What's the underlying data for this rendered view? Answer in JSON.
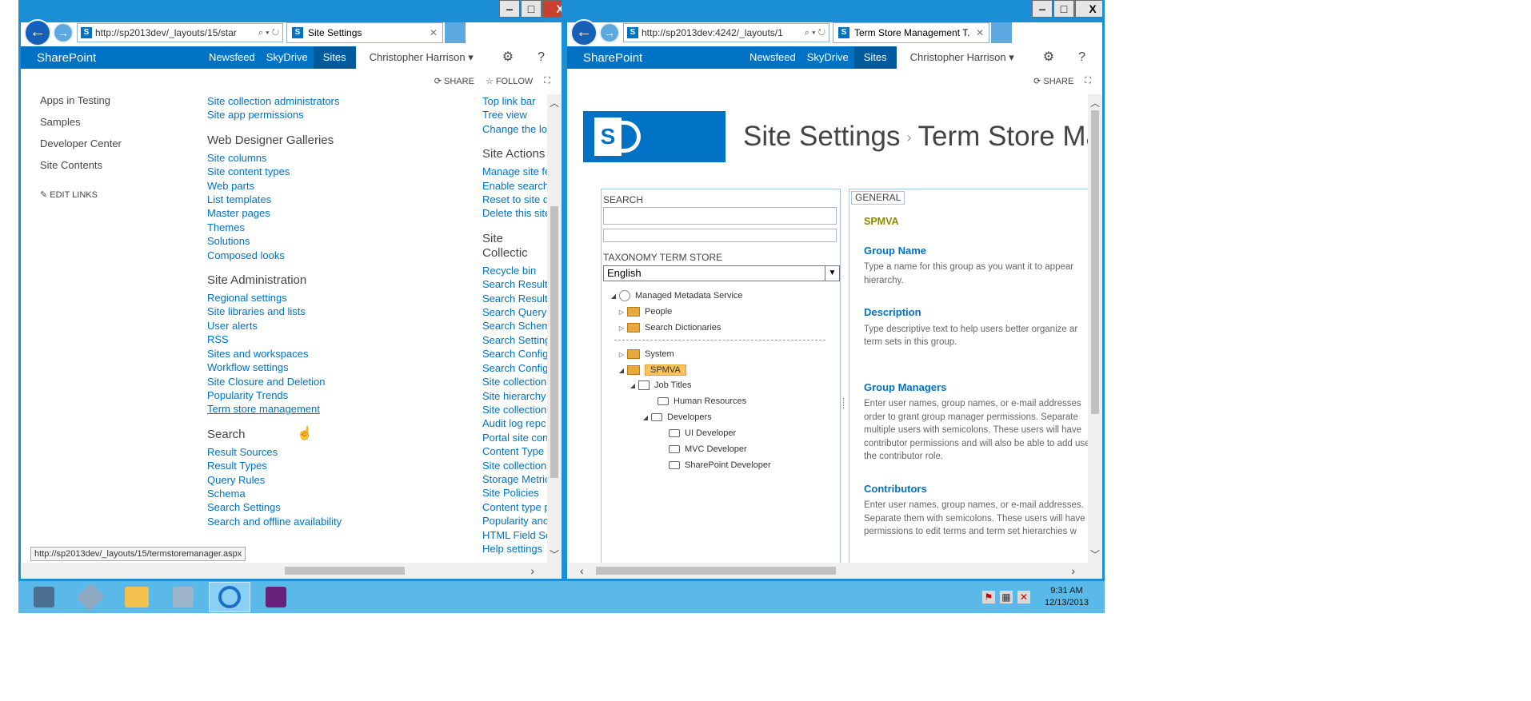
{
  "left_window": {
    "url": "http://sp2013dev/_layouts/15/star",
    "url_host": "sp2013dev",
    "url_tools": "⌕ ▾ ↻",
    "tab_title": "Site Settings",
    "suite": {
      "brand": "SharePoint",
      "links": [
        "Newsfeed",
        "SkyDrive",
        "Sites"
      ],
      "user": "Christopher Harrison ▾"
    },
    "actions": [
      "⟳ SHARE",
      "☆ FOLLOW",
      "⛶"
    ],
    "quicklaunch": [
      "Apps in Testing",
      "Samples",
      "Developer Center",
      "Site Contents"
    ],
    "edit_links": "✎  EDIT LINKS",
    "col1": {
      "top_links": [
        "Site collection administrators",
        "Site app permissions"
      ],
      "web_designer_header": "Web Designer Galleries",
      "web_designer": [
        "Site columns",
        "Site content types",
        "Web parts",
        "List templates",
        "Master pages",
        "Themes",
        "Solutions",
        "Composed looks"
      ],
      "site_admin_header": "Site Administration",
      "site_admin": [
        "Regional settings",
        "Site libraries and lists",
        "User alerts",
        "RSS",
        "Sites and workspaces",
        "Workflow settings",
        "Site Closure and Deletion",
        "Popularity Trends",
        "Term store management"
      ],
      "search_header": "Search",
      "search": [
        "Result Sources",
        "Result Types",
        "Query Rules",
        "Schema",
        "Search Settings",
        "Search and offline availability"
      ]
    },
    "col2": {
      "top_links": [
        "Top link bar",
        "Tree view",
        "Change the lo"
      ],
      "site_actions_header": "Site Actions",
      "site_actions": [
        "Manage site fe",
        "Enable search",
        "Reset to site d",
        "Delete this site"
      ],
      "site_coll_header": "Site Collectic",
      "site_coll": [
        "Recycle bin",
        "Search Result",
        "Search Result",
        "Search Query",
        "Search Schem",
        "Search Setting",
        "Search Config",
        "Search Config",
        "Site collection",
        "Site hierarchy",
        "Site collection",
        "Audit log repc",
        "Portal site con",
        "Content Type",
        "Site collection",
        "Storage Metric",
        "Site Policies",
        "Content type p",
        "Popularity anc",
        "HTML Field Se",
        "Help settings"
      ]
    },
    "status_url": "http://sp2013dev/_layouts/15/termstoremanager.aspx"
  },
  "right_window": {
    "url": "http://sp2013dev:4242/_layouts/1",
    "url_tools": "⌕ ▾ ↻",
    "tab_title": "Term Store Management T...",
    "suite": {
      "brand": "SharePoint",
      "links": [
        "Newsfeed",
        "SkyDrive",
        "Sites"
      ],
      "user": "Christopher Harrison ▾"
    },
    "actions": [
      "⟳ SHARE",
      "⛶"
    ],
    "page_title_1": "Site Settings",
    "page_title_sep": "›",
    "page_title_2": "Term Store Ma",
    "search_label": "SEARCH",
    "taxonomy_label": "TAXONOMY TERM STORE",
    "language": "English",
    "tree": [
      {
        "label": "Managed Metadata Service",
        "exp": "◢"
      },
      {
        "label": "People",
        "exp": "▷"
      },
      {
        "label": "Search Dictionaries",
        "exp": "▷"
      },
      {
        "label": "System",
        "exp": "▷"
      },
      {
        "label": "SPMVA",
        "exp": "◢"
      },
      {
        "label": "Job Titles",
        "exp": "◢"
      },
      {
        "label": "Human Resources",
        "exp": ""
      },
      {
        "label": "Developers",
        "exp": "◢"
      },
      {
        "label": "UI Developer",
        "exp": ""
      },
      {
        "label": "MVC Developer",
        "exp": ""
      },
      {
        "label": "SharePoint Developer",
        "exp": ""
      }
    ],
    "general_tab": "GENERAL",
    "group_name_value": "SPMVA",
    "props": [
      {
        "header": "Group Name",
        "desc": [
          "Type a name for this group as you want it to appear",
          "hierarchy."
        ]
      },
      {
        "header": "Description",
        "desc": [
          "Type descriptive text to help users better organize ar",
          "term sets in this group."
        ]
      },
      {
        "header": "Group Managers",
        "desc": [
          "Enter user names, group names, or e-mail addresses",
          "order to grant group manager permissions. Separate",
          "multiple users with semicolons. These users will have",
          "contributor permissions and will also be able to add use",
          "the contributor role."
        ]
      },
      {
        "header": "Contributors",
        "desc": [
          "Enter user names, group names, or e-mail addresses.",
          "Separate them with semicolons. These users will have",
          "permissions to edit terms and term set hierarchies w"
        ]
      }
    ]
  },
  "window_controls": [
    "‒",
    "□",
    "X"
  ],
  "taskbar": {
    "clock_time": "9:31 AM",
    "clock_date": "12/13/2013",
    "items": [
      "server-manager",
      "tools",
      "file-explorer",
      "admin-tools",
      "internet-explorer",
      "visual-studio"
    ]
  },
  "colors": {
    "desktop": "#1a8fd6",
    "suite": "#0072c6",
    "taskbar": "#5bb9ea"
  }
}
